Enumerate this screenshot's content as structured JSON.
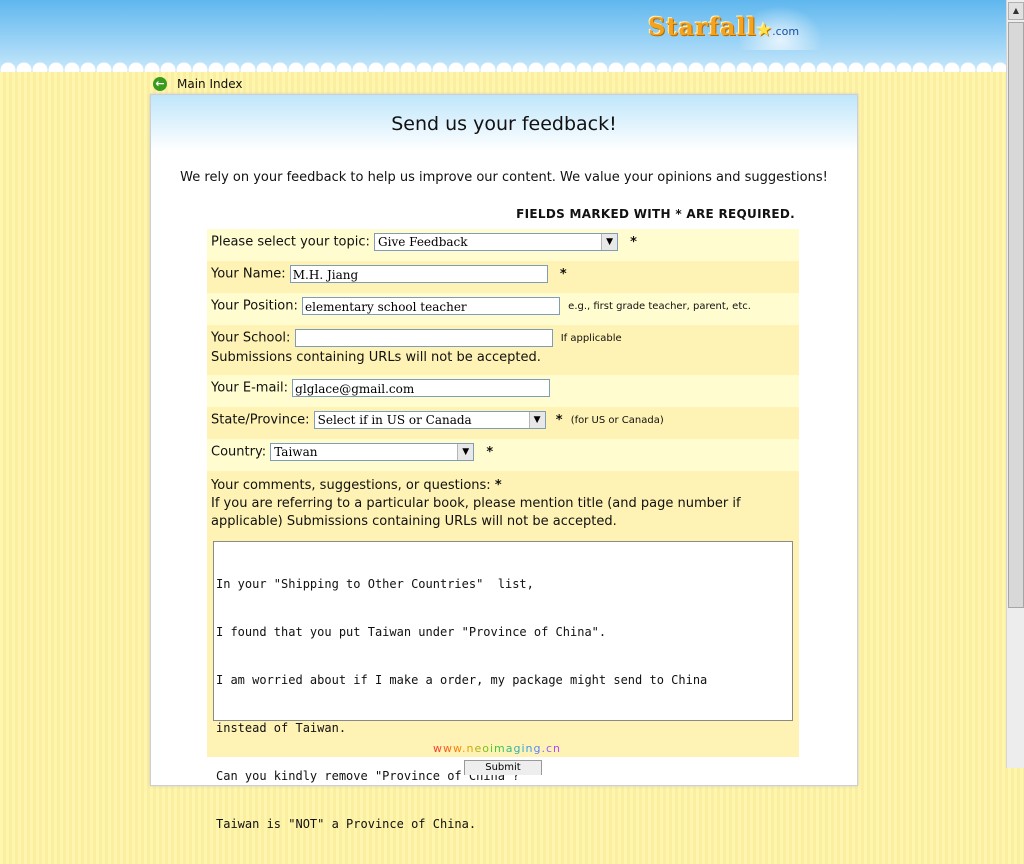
{
  "header": {
    "logo_text": "Starfall",
    "logo_suffix": ".com"
  },
  "nav": {
    "back_label": "Main Index"
  },
  "page": {
    "title": "Send us your feedback!",
    "intro": "We rely on your feedback to help us improve our content. We value your opinions and suggestions!",
    "required_note": "FIELDS MARKED WITH * ARE REQUIRED."
  },
  "form": {
    "topic_label": "Please select your topic:",
    "topic_value": "Give Feedback",
    "name_label": "Your Name:",
    "name_value": "M.H. Jiang",
    "position_label": "Your Position:",
    "position_value": "elementary school teacher",
    "position_hint": "e.g., first grade teacher, parent, etc.",
    "school_label": "Your School:",
    "school_value": "",
    "school_hint": "If applicable",
    "school_note": "Submissions containing URLs will not be accepted.",
    "email_label": "Your E-mail:",
    "email_value": "glglace@gmail.com",
    "state_label": "State/Province:",
    "state_value": "Select if in US or Canada",
    "state_hint": "(for US or Canada)",
    "country_label": "Country:",
    "country_value": "Taiwan",
    "comments_label": "Your comments, suggestions, or questions:",
    "comments_note": "If you are referring to a particular book, please mention title (and page number if applicable) Submissions containing URLs will not be accepted.",
    "comments_lines": [
      "In your \"Shipping to Other Countries\"  list,",
      "I found that you put Taiwan under \"Province of China\".",
      "I am worried about if I make a order, my package might send to China",
      "instead of Taiwan.",
      "Can you kindly remove \"Province of China\"?",
      "Taiwan is \"NOT\" a Province of China."
    ],
    "required_mark": "*",
    "submit_label": "Submit"
  },
  "watermark": "www.neoimaging.cn"
}
